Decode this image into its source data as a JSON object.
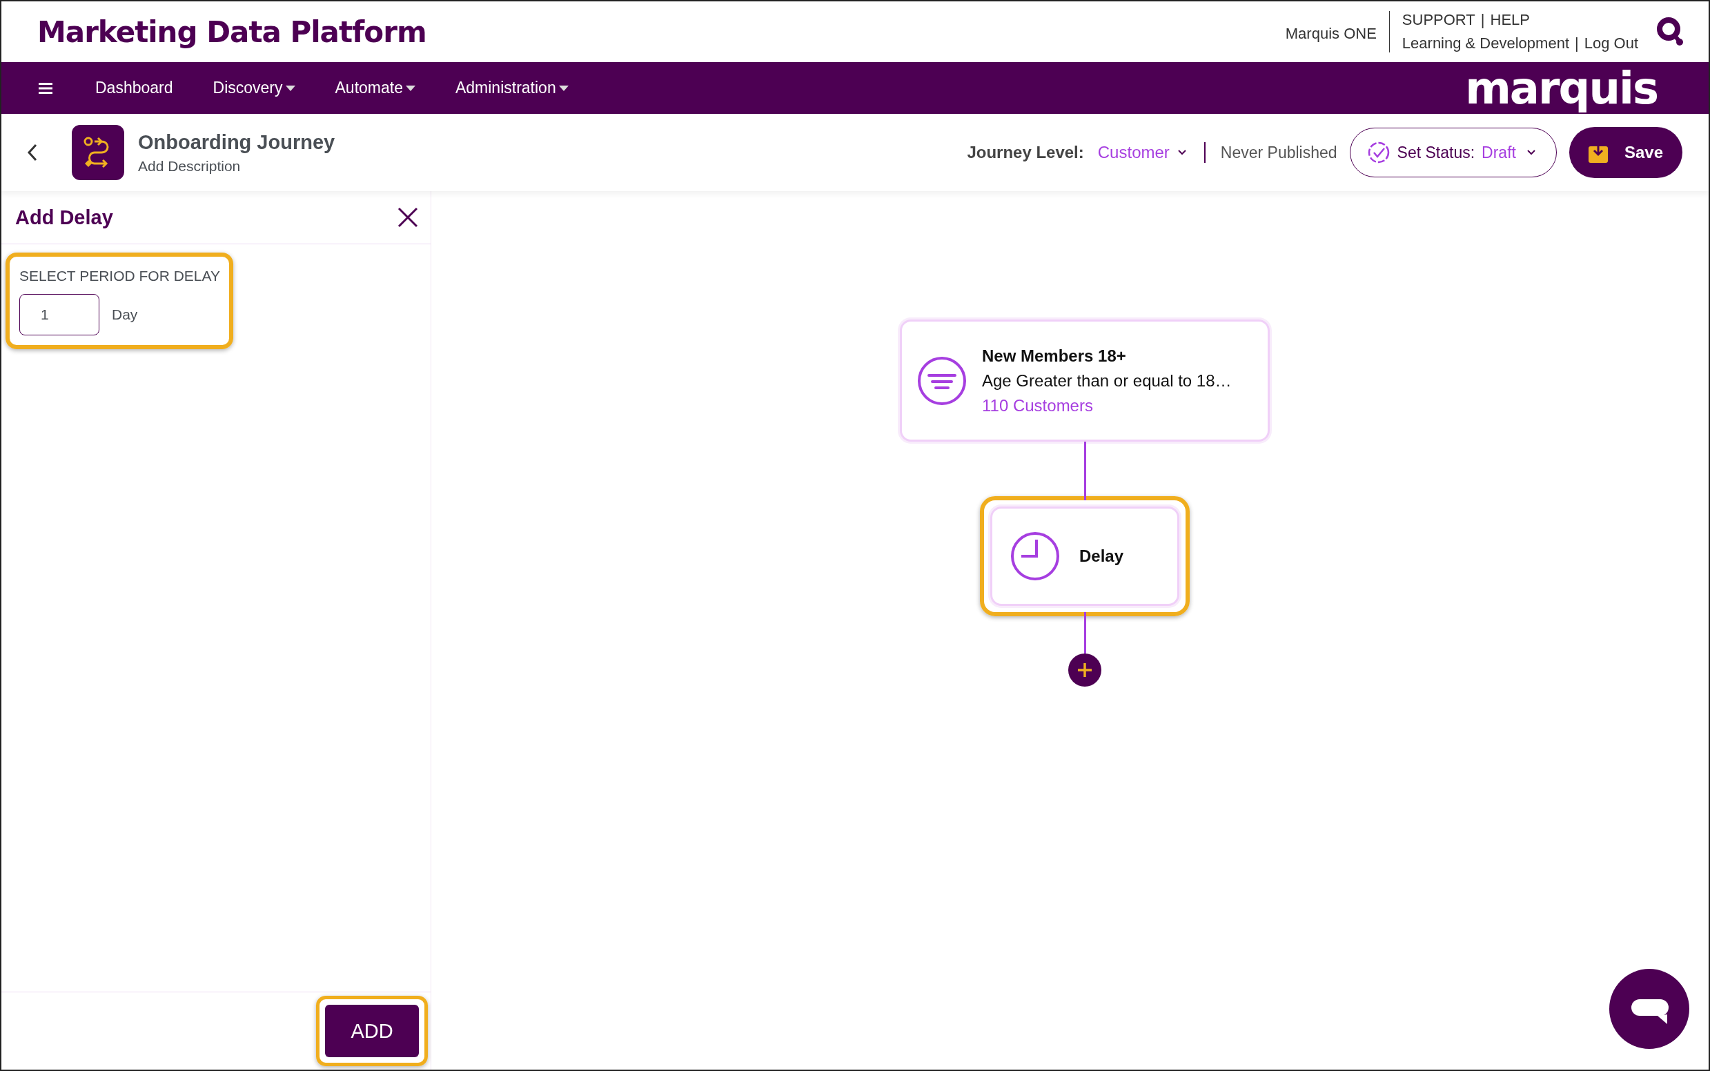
{
  "header": {
    "title": "Marketing Data Platform",
    "product_link": "Marquis ONE",
    "separator": "|",
    "link_rows": [
      [
        "SUPPORT",
        "HELP"
      ],
      [
        "Learning & Development",
        "Log Out"
      ]
    ]
  },
  "nav": {
    "items": [
      {
        "label": "Dashboard",
        "dropdown": false
      },
      {
        "label": "Discovery",
        "dropdown": true
      },
      {
        "label": "Automate",
        "dropdown": true
      },
      {
        "label": "Administration",
        "dropdown": true
      }
    ],
    "brand": "marquis"
  },
  "journey": {
    "title": "Onboarding Journey",
    "description": "Add Description",
    "level_label": "Journey Level:",
    "level_value": "Customer",
    "publish_state": "Never Published",
    "status_label": "Set Status:",
    "status_value": "Draft",
    "save": "Save"
  },
  "panel": {
    "title": "Add Delay",
    "field_label": "SELECT PERIOD FOR DELAY",
    "field_value": "1",
    "unit": "Day",
    "field_highlighted": true,
    "button": "ADD",
    "button_highlighted": true
  },
  "canvas": {
    "nodes": [
      {
        "kind": "segment",
        "title": "New Members 18+",
        "description": "Age Greater than or equal to 18…",
        "count": "110 Customers",
        "highlighted": false
      },
      {
        "kind": "delay",
        "title": "Delay",
        "highlighted": true
      }
    ]
  }
}
